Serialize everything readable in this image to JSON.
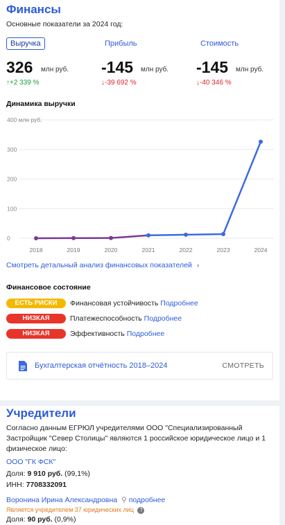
{
  "finance": {
    "title": "Финансы",
    "subtitle": "Основные показатели за 2024 год:",
    "metrics": [
      {
        "label": "Выручка",
        "value": "326",
        "unit": "млн руб.",
        "change": "↑+2 339 %",
        "dir": "up"
      },
      {
        "label": "Прибыль",
        "value": "-145",
        "unit": "млн руб.",
        "change": "↓-39 692 %",
        "dir": "down"
      },
      {
        "label": "Стоимость",
        "value": "-145",
        "unit": "млн руб.",
        "change": "↓-40 346 %",
        "dir": "down"
      }
    ],
    "chart_title": "Динамика выручки",
    "details_link": "Смотреть детальный анализ финансовых показателей",
    "state_title": "Финансовое состояние",
    "state": [
      {
        "badge": "ЕСТЬ РИСКИ",
        "kind": "warn",
        "label": "Финансовая устойчивость",
        "more": "Подробнее"
      },
      {
        "badge": "НИЗКАЯ",
        "kind": "bad",
        "label": "Платежеспособность",
        "more": "Подробнее"
      },
      {
        "badge": "НИЗКАЯ",
        "kind": "bad",
        "label": "Эффективность",
        "more": "Подробнее"
      }
    ],
    "report_label": "Бухгалтерская отчётность 2018–2024",
    "report_action": "СМОТРЕТЬ"
  },
  "chart_data": {
    "type": "line",
    "x": [
      "2018",
      "2019",
      "2020",
      "2021",
      "2022",
      "2023",
      "2024"
    ],
    "values": [
      0,
      0.5,
      1,
      10,
      12,
      14,
      326
    ],
    "ylim": [
      0,
      400
    ],
    "yticks": [
      "400 млн руб.",
      "300",
      "200",
      "100",
      "0"
    ],
    "grid": true,
    "colors": {
      "line": "#3b6be0",
      "early": "#7b3a93"
    }
  },
  "founders": {
    "title": "Учредители",
    "text": "Согласно данным ЕГРЮЛ учредителями ООО \"Специализированный Застройщик \"Север Столицы\" являются 1 российское юридическое лицо и 1 физическое лицо:",
    "org": {
      "name": "ООО \"ГК ФСК\"",
      "share_label": "Доля:",
      "share_value": "9 910 руб.",
      "share_pct": "(99,1%)",
      "inn_label": "ИНН:",
      "inn_value": "7708332091"
    },
    "person": {
      "name": "Воронина Ирина Александровна",
      "more": "подробнее",
      "note": "Является учредителем 37 юридических лиц",
      "share_label": "Доля:",
      "share_value": "90 руб.",
      "share_pct": "(0,9%)"
    }
  }
}
